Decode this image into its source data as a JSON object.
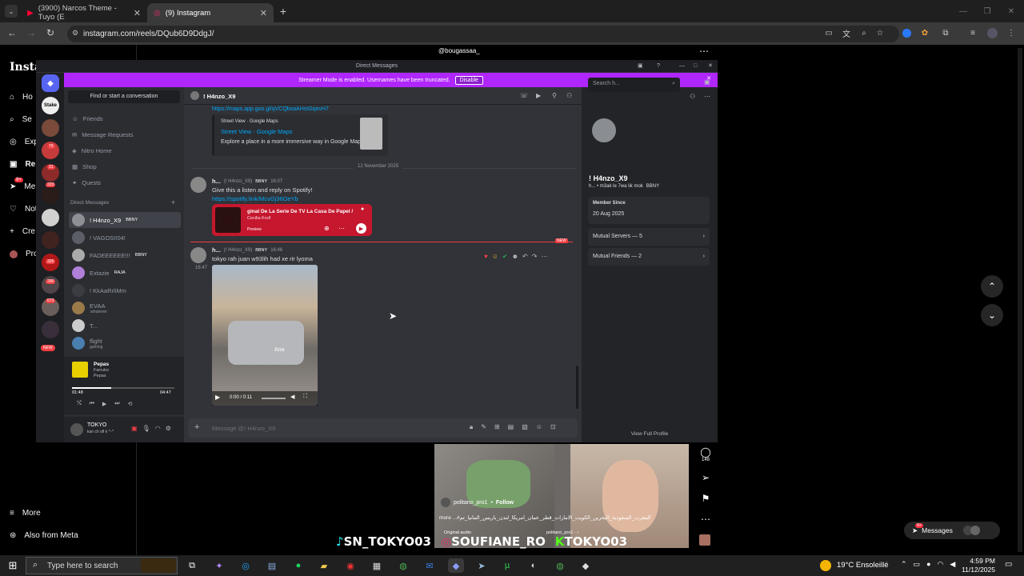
{
  "browser": {
    "tabs": [
      {
        "title": "(3900) Narcos Theme - Tuyo (E",
        "icon": "youtube-icon"
      },
      {
        "title": "(9) Instagram",
        "icon": "instagram-icon"
      }
    ],
    "url": "instagram.com/reels/DQub6D9DdgJ/"
  },
  "instagram": {
    "logo": "Instag",
    "nav": [
      "Ho",
      "Se",
      "Exp",
      "Re",
      "Me",
      "Not",
      "Cre",
      "Pro"
    ],
    "notif_badge": "9+",
    "more_label": "More",
    "also_meta_label": "Also from Meta",
    "reel_username_top": "@bougassaa_",
    "reel_user": "politano_pro1",
    "reel_follow": "Follow",
    "reel_caption": "more ...#المغرب_السعودية_البحرين_الكويت_الامارات_قطر_عمان_امريكا_لندن_باريس_المانيا_تم",
    "reel_audio": "Original audio",
    "reel_audio_user": "politano_pro1 · ‹",
    "comments_count": "148",
    "overlay_handles": [
      "SN_TOKYO03",
      "SOUFIANE_RO",
      "TOKYO03"
    ],
    "messages_label": "Messages",
    "messages_badge": "9+"
  },
  "discord": {
    "window_title": "Direct Messages",
    "banner_text": "Streamer Mode is enabled. Usernames have been truncated.",
    "banner_button": "Disable",
    "search_conversation": "Find or start a conversation",
    "menu": [
      "Friends",
      "Message Requests",
      "Nitro Home",
      "Shop",
      "Quests"
    ],
    "dm_header": "Direct Messages",
    "dms": [
      {
        "name": "! H4nzo_X9",
        "tag": "BBNY"
      },
      {
        "name": "! VAGOSI!04!",
        "tag": ""
      },
      {
        "name": "FADEEEEEE!!!",
        "tag": "BBNY"
      },
      {
        "name": "Extazie",
        "tag": "RAJA"
      },
      {
        "name": "! KkAaRrliMm",
        "tag": ""
      },
      {
        "name": "EVAA",
        "tag": "",
        "status": ":whatever"
      },
      {
        "name": "T...",
        "tag": ""
      },
      {
        "name": "flight",
        "tag": "",
        "status": "gaming"
      }
    ],
    "server_badges": [
      "79",
      "31",
      "223",
      "326",
      "266",
      "673"
    ],
    "new_label": "NEW",
    "music": {
      "title": "Pepas",
      "artist": "Farruko",
      "album": "Pepas",
      "elapsed": "01:48",
      "total": "04:47",
      "progress": 0.38
    },
    "user": {
      "name": "TOKYO",
      "status": "kan ch ofl k ^-^"
    },
    "chat_header": "! H4nzo_X9",
    "chat_search_placeholder": "Search h...",
    "embed_link_top": "https://maps.app.goo.gl/qVCQbxaAHstGqevH7",
    "embed_provider": "Street View · Google Maps",
    "embed_title": "Street View - Google Maps",
    "embed_desc": "Explore a place in a more immersive way in Google Maps.",
    "date_divider": "12 November 2025",
    "msg1": {
      "author": "h...",
      "author_full": "(! H4nzo_X9)",
      "tag": "BBNY",
      "time": "16:07",
      "text": "Give this a listen and reply on Spotify!",
      "link": "https://spotify.link/McvGj36OeYb"
    },
    "spotify": {
      "title": "ginal De La Serie De TV La Casa De Papel /",
      "artist": "Cecilia Krull",
      "preview": "Preview"
    },
    "new_marker": "NEW",
    "msg2": {
      "author": "h...",
      "author_full": "(! H4nzo_X9)",
      "tag": "BBNY",
      "time": "16:46",
      "time_side": "16:47",
      "text": "tokyo rah juan w93lih had xe rir lyoma"
    },
    "video": {
      "time": "0:00 / 0:11",
      "overlay_text": "Ana"
    },
    "composer_placeholder": "Message @! H4nzo_X9",
    "profile": {
      "name": "! H4nzo_X9",
      "subtitle": "h... • m3ak le 7wa lik mok",
      "tag": "BBNY",
      "member_since_label": "Member Since",
      "member_since": "20 Aug 2025",
      "mutual_servers": "Mutual Servers — 5",
      "mutual_friends": "Mutual Friends — 2",
      "view_full": "View Full Profile"
    }
  },
  "taskbar": {
    "search_placeholder": "Type here to search",
    "weather": "19°C Ensoleillé",
    "time": "4:59 PM",
    "date": "11/12/2025"
  }
}
